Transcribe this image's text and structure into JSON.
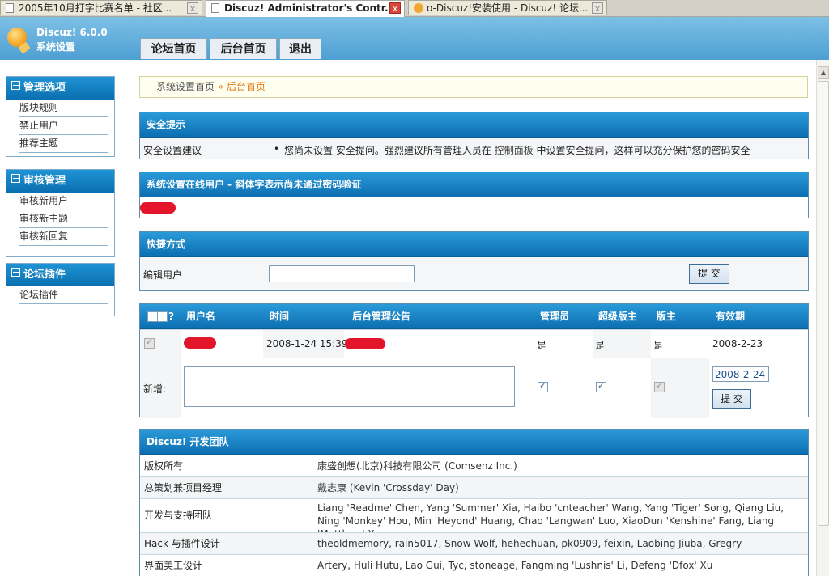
{
  "browser": {
    "tabs": [
      {
        "title": "2005年10月打字比赛名单 - 社区...",
        "close": "x"
      },
      {
        "title": "Discuz! Administrator's Contr...",
        "close": "x"
      },
      {
        "title": "o-Discuz!安装使用 - Discuz! 论坛...",
        "close": "x"
      }
    ]
  },
  "header": {
    "app_name": "Discuz! 6.0.0",
    "subtitle": "系统设置",
    "nav": [
      "论坛首页",
      "后台首页",
      "退出"
    ]
  },
  "sidebar": [
    {
      "title": "管理选项",
      "items": [
        "版块规则",
        "禁止用户",
        "推荐主题"
      ]
    },
    {
      "title": "审核管理",
      "items": [
        "审核新用户",
        "审核新主题",
        "审核新回复"
      ]
    },
    {
      "title": "论坛插件",
      "items": [
        "论坛插件"
      ]
    }
  ],
  "breadcrumb": {
    "home": "系统设置首页",
    "sep": " » ",
    "current": "后台首页"
  },
  "security": {
    "title": "安全提示",
    "label": "安全设置建议",
    "bullet": "•",
    "msg_a": "您尚未设置",
    "link1": "安全提问",
    "msg_b": "。强烈建议所有管理人员在",
    "link2": "控制面板",
    "msg_c": "中设置安全提问，这样可以充分保护您的密码安全"
  },
  "online": {
    "title": "系统设置在线用户 - 斜体字表示尚未通过密码验证"
  },
  "shortcut": {
    "title": "快捷方式",
    "label": "编辑用户",
    "input_value": "",
    "submit": "提 交"
  },
  "announce": {
    "headers": {
      "check": "?",
      "user": "用户名",
      "time": "时间",
      "notice": "后台管理公告",
      "admin": "管理员",
      "super": "超级版主",
      "mod": "版主",
      "expiry": "有效期"
    },
    "row": {
      "time": "2008-1-24 15:39",
      "admin": "是",
      "super": "是",
      "mod": "是",
      "expiry": "2008-2-23"
    },
    "new_label": "新增:",
    "new_expiry": "2008-2-24",
    "submit": "提 交"
  },
  "team": {
    "title": "Discuz! 开发团队",
    "rows": [
      {
        "k": "版权所有",
        "v": "康盛创想(北京)科技有限公司 (Comsenz Inc.)"
      },
      {
        "k": "总策划兼项目经理",
        "v": "戴志康 (Kevin 'Crossday' Day)"
      },
      {
        "k": "开发与支持团队",
        "v": "Liang 'Readme' Chen, Yang 'Summer' Xia, Haibo 'cnteacher' Wang, Yang 'Tiger' Song, Qiang Liu, Ning 'Monkey' Hou, Min 'Heyond' Huang, Chao 'Langwan' Luo, XiaoDun 'Kenshine' Fang, Liang 'Metthew' Xu"
      },
      {
        "k": "Hack 与插件设计",
        "v": "theoldmemory, rain5017, Snow Wolf, hehechuan, pk0909, feixin, Laobing Jiuba, Gregry"
      },
      {
        "k": "界面美工设计",
        "v": "Artery, Huli Hutu, Lao Gui, Tyc, stoneage, Fangming 'Lushnis' Li, Defeng 'Dfox' Xu"
      }
    ]
  }
}
